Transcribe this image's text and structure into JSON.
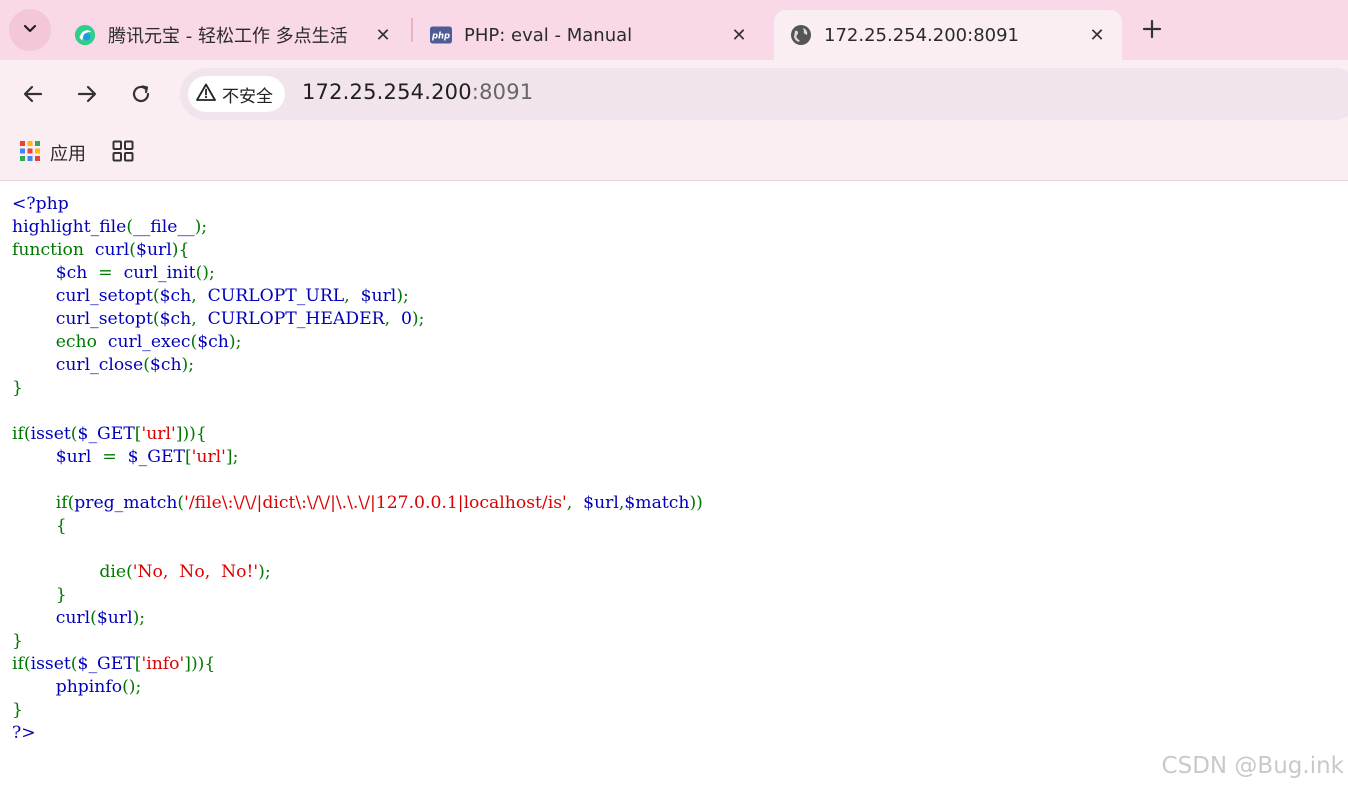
{
  "tabs": [
    {
      "title": "腾讯元宝 - 轻松工作 多点生活",
      "icon": "yuanbao-icon",
      "active": false
    },
    {
      "title": "PHP: eval - Manual",
      "icon": "php-icon",
      "favicon_text": "php",
      "active": false
    },
    {
      "title": "172.25.254.200:8091",
      "icon": "globe-icon",
      "active": true
    }
  ],
  "toolbar": {
    "security_label": "不安全",
    "url_host": "172.25.254.200",
    "url_port": ":8091"
  },
  "bookmarks": {
    "apps_label": "应用"
  },
  "code": {
    "lines": [
      [
        [
          "def",
          "<?php"
        ]
      ],
      [
        [
          "def",
          "highlight_file"
        ],
        [
          "kw",
          "("
        ],
        [
          "def",
          "__file__"
        ],
        [
          "kw",
          ");"
        ]
      ],
      [
        [
          "kw",
          "function "
        ],
        [
          "def",
          " curl"
        ],
        [
          "kw",
          "("
        ],
        [
          "def",
          "$url"
        ],
        [
          "kw",
          "){"
        ]
      ],
      [
        [
          "def",
          "        $ch "
        ],
        [
          "kw",
          " = "
        ],
        [
          "def",
          " curl_init"
        ],
        [
          "kw",
          "();"
        ]
      ],
      [
        [
          "def",
          "        curl_setopt"
        ],
        [
          "kw",
          "("
        ],
        [
          "def",
          "$ch"
        ],
        [
          "kw",
          ", "
        ],
        [
          "def",
          " CURLOPT_URL"
        ],
        [
          "kw",
          ", "
        ],
        [
          "def",
          " $url"
        ],
        [
          "kw",
          ");"
        ]
      ],
      [
        [
          "def",
          "        curl_setopt"
        ],
        [
          "kw",
          "("
        ],
        [
          "def",
          "$ch"
        ],
        [
          "kw",
          ", "
        ],
        [
          "def",
          " CURLOPT_HEADER"
        ],
        [
          "kw",
          ", "
        ],
        [
          "def",
          " 0"
        ],
        [
          "kw",
          ");"
        ]
      ],
      [
        [
          "kw",
          "        echo "
        ],
        [
          "def",
          " curl_exec"
        ],
        [
          "kw",
          "("
        ],
        [
          "def",
          "$ch"
        ],
        [
          "kw",
          ");"
        ]
      ],
      [
        [
          "def",
          "        curl_close"
        ],
        [
          "kw",
          "("
        ],
        [
          "def",
          "$ch"
        ],
        [
          "kw",
          ");"
        ]
      ],
      [
        [
          "kw",
          "}"
        ]
      ],
      [],
      [
        [
          "kw",
          "if("
        ],
        [
          "def",
          "isset"
        ],
        [
          "kw",
          "("
        ],
        [
          "def",
          "$_GET"
        ],
        [
          "kw",
          "["
        ],
        [
          "str",
          "'url'"
        ],
        [
          "kw",
          "])){"
        ]
      ],
      [
        [
          "def",
          "        $url "
        ],
        [
          "kw",
          " = "
        ],
        [
          "def",
          " $_GET"
        ],
        [
          "kw",
          "["
        ],
        [
          "str",
          "'url'"
        ],
        [
          "kw",
          "];"
        ]
      ],
      [],
      [
        [
          "kw",
          "        if("
        ],
        [
          "def",
          "preg_match"
        ],
        [
          "kw",
          "("
        ],
        [
          "str",
          "'/file\\:\\/\\/|dict\\:\\/\\/|\\.\\.\\/|127.0.0.1|localhost/is'"
        ],
        [
          "kw",
          ", "
        ],
        [
          "def",
          " $url"
        ],
        [
          "kw",
          ","
        ],
        [
          "def",
          "$match"
        ],
        [
          "kw",
          "))"
        ]
      ],
      [
        [
          "kw",
          "        {"
        ]
      ],
      [],
      [
        [
          "kw",
          "                die("
        ],
        [
          "str",
          "'No, "
        ],
        [
          "str",
          " No, "
        ],
        [
          "str",
          " No!'"
        ],
        [
          "kw",
          ");"
        ]
      ],
      [
        [
          "kw",
          "        }"
        ]
      ],
      [
        [
          "def",
          "        curl"
        ],
        [
          "kw",
          "("
        ],
        [
          "def",
          "$url"
        ],
        [
          "kw",
          ");"
        ]
      ],
      [
        [
          "kw",
          "}"
        ]
      ],
      [
        [
          "kw",
          "if("
        ],
        [
          "def",
          "isset"
        ],
        [
          "kw",
          "("
        ],
        [
          "def",
          "$_GET"
        ],
        [
          "kw",
          "["
        ],
        [
          "str",
          "'info'"
        ],
        [
          "kw",
          "])){"
        ]
      ],
      [
        [
          "def",
          "        phpinfo"
        ],
        [
          "kw",
          "();"
        ]
      ],
      [
        [
          "kw",
          "}"
        ]
      ],
      [
        [
          "def",
          "?>"
        ]
      ]
    ]
  },
  "watermark": "CSDN @Bug.ink",
  "colors": {
    "tabstrip_bg": "#f9d9e7",
    "toolbar_bg": "#fbeef3",
    "php_default": "#0000bb",
    "php_keyword": "#007700",
    "php_string": "#dd0000"
  }
}
